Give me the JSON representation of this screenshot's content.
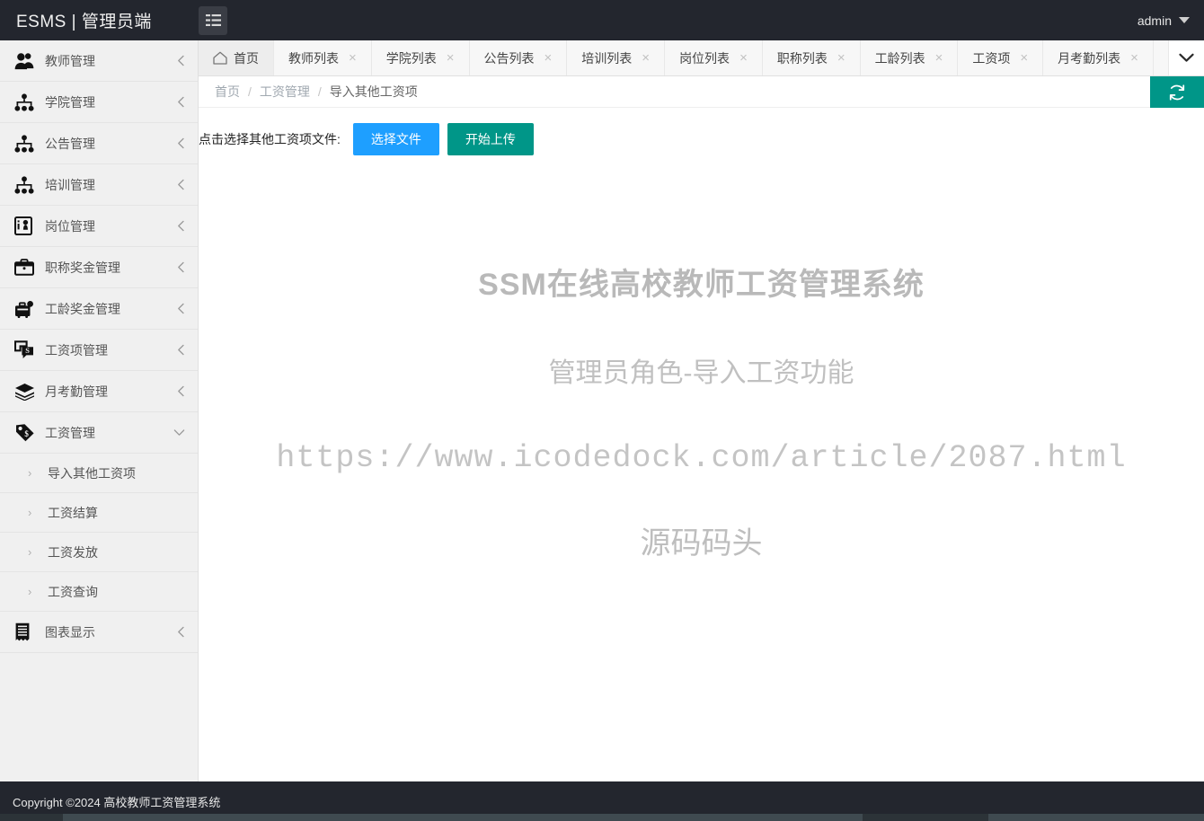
{
  "header": {
    "brand": "ESMS | 管理员端",
    "menu_toggle_icon": "hamburger-menu-icon",
    "user": "admin"
  },
  "sidebar": {
    "items": [
      {
        "label": "教师管理",
        "icon": "users-group-icon",
        "arrow": "chevron-left",
        "expanded": false
      },
      {
        "label": "学院管理",
        "icon": "org-tree-icon",
        "arrow": "chevron-left",
        "expanded": false
      },
      {
        "label": "公告管理",
        "icon": "org-tree-icon",
        "arrow": "chevron-left",
        "expanded": false
      },
      {
        "label": "培训管理",
        "icon": "org-tree-icon",
        "arrow": "chevron-left",
        "expanded": false
      },
      {
        "label": "岗位管理",
        "icon": "id-badge-icon",
        "arrow": "chevron-left",
        "expanded": false
      },
      {
        "label": "职称奖金管理",
        "icon": "briefcase-icon",
        "arrow": "chevron-left",
        "expanded": false
      },
      {
        "label": "工龄奖金管理",
        "icon": "money-briefcase-icon",
        "arrow": "chevron-left",
        "expanded": false
      },
      {
        "label": "工资项管理",
        "icon": "money-bubble-icon",
        "arrow": "chevron-left",
        "expanded": false
      },
      {
        "label": "月考勤管理",
        "icon": "layers-stack-icon",
        "arrow": "chevron-left",
        "expanded": false
      },
      {
        "label": "工资管理",
        "icon": "price-tag-money-icon",
        "arrow": "chevron-down",
        "expanded": true
      }
    ],
    "sub_items": [
      {
        "label": "导入其他工资项",
        "chevron": "chevron-right-icon"
      },
      {
        "label": "工资结算",
        "chevron": "chevron-right-icon"
      },
      {
        "label": "工资发放",
        "chevron": "chevron-right-icon"
      },
      {
        "label": "工资查询",
        "chevron": "chevron-right-icon"
      }
    ],
    "trailing_items": [
      {
        "label": "图表显示",
        "icon": "receipt-chart-icon",
        "arrow": "chevron-left"
      }
    ]
  },
  "tabs": {
    "items": [
      {
        "label": "首页",
        "icon": "home-icon",
        "closable": false,
        "active": true
      },
      {
        "label": "教师列表",
        "closable": true,
        "active": false
      },
      {
        "label": "学院列表",
        "closable": true,
        "active": false
      },
      {
        "label": "公告列表",
        "closable": true,
        "active": false
      },
      {
        "label": "培训列表",
        "closable": true,
        "active": false
      },
      {
        "label": "岗位列表",
        "closable": true,
        "active": false
      },
      {
        "label": "职称列表",
        "closable": true,
        "active": false
      },
      {
        "label": "工龄列表",
        "closable": true,
        "active": false
      },
      {
        "label": "工资项",
        "closable": true,
        "active": false
      },
      {
        "label": "月考勤列表",
        "closable": true,
        "active": false
      }
    ],
    "close_glyph": "×",
    "more_icon": "chevron-down-icon"
  },
  "breadcrumb": {
    "items": [
      "首页",
      "工资管理",
      "导入其他工资项"
    ],
    "separator": "/",
    "refresh_icon": "refresh-icon"
  },
  "main": {
    "upload_label": "点击选择其他工资项文件:",
    "choose_file_button": "选择文件",
    "start_upload_button": "开始上传",
    "watermark": {
      "line1": "SSM在线高校教师工资管理系统",
      "line2": "管理员角色-导入工资功能",
      "line3": "https://www.icodedock.com/article/2087.html",
      "line4": "源码码头"
    }
  },
  "footer": {
    "text": "Copyright ©2024 高校教师工资管理系统"
  },
  "colors": {
    "header_bg": "#23262e",
    "sidebar_bg": "#f0f0f0",
    "accent_blue": "#1E9FFF",
    "accent_teal": "#009688",
    "watermark_gray": "#bfbfbf"
  }
}
